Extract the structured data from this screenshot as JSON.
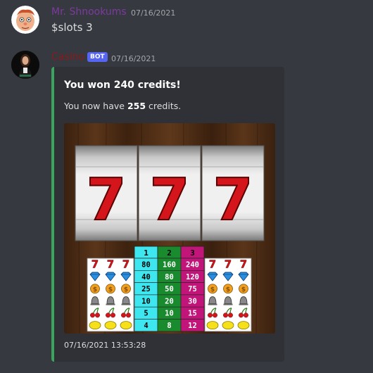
{
  "message1": {
    "username": "Mr. Shnookums",
    "username_color": "#7d3a9e",
    "timestamp": "07/16/2021",
    "content": "$slots 3"
  },
  "message2": {
    "username": "Casino",
    "username_color": "#8b1a1a",
    "bot_badge": "BOT",
    "timestamp": "07/16/2021",
    "embed": {
      "accent_color": "#3ba55d",
      "title": "You won 240 credits!",
      "description_prefix": "You now have ",
      "credits": "255",
      "description_suffix": " credits.",
      "footer": "07/16/2021 13:53:28",
      "slot_machine": {
        "reels": [
          "7",
          "7",
          "7"
        ],
        "paytable": {
          "headers": [
            "1",
            "2",
            "3"
          ],
          "header_colors": [
            "#3ee6f0",
            "#1a8a2e",
            "#c2157a"
          ],
          "rows": [
            {
              "symbol": "seven-icon",
              "values": [
                "80",
                "160",
                "240"
              ]
            },
            {
              "symbol": "diamond-icon",
              "values": [
                "40",
                "80",
                "120"
              ]
            },
            {
              "symbol": "coin-icon",
              "values": [
                "25",
                "50",
                "75"
              ]
            },
            {
              "symbol": "bell-icon",
              "values": [
                "10",
                "20",
                "30"
              ]
            },
            {
              "symbol": "cherry-icon",
              "values": [
                "5",
                "10",
                "15"
              ]
            },
            {
              "symbol": "lemon-icon",
              "values": [
                "4",
                "8",
                "12"
              ]
            }
          ]
        }
      }
    }
  }
}
